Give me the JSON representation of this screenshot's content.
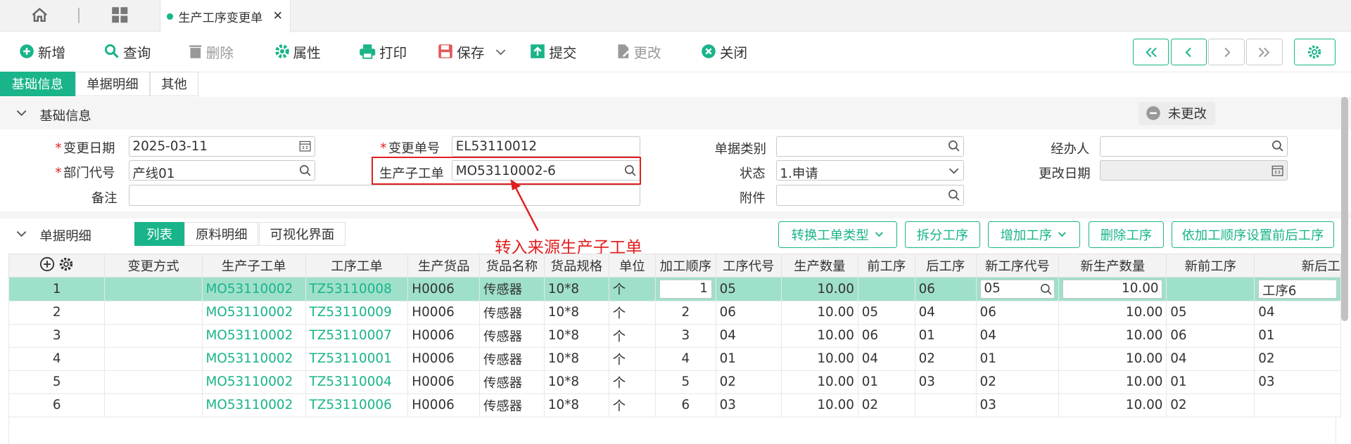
{
  "tabs": {
    "active": "生产工序变更单"
  },
  "toolbar": {
    "new": "新增",
    "query": "查询",
    "delete": "删除",
    "properties": "属性",
    "print": "打印",
    "save": "保存",
    "submit": "提交",
    "modify": "更改",
    "close": "关闭"
  },
  "subtabs": [
    "基础信息",
    "单据明细",
    "其他"
  ],
  "section_basic": {
    "title": "基础信息",
    "status_badge": "未更改"
  },
  "form": {
    "change_date_label": "变更日期",
    "change_date": "2025-03-11",
    "change_no_label": "变更单号",
    "change_no": "EL53110012",
    "doc_type_label": "单据类别",
    "doc_type": "",
    "handler_label": "经办人",
    "handler": "",
    "dept_label": "部门代号",
    "dept": "产线01",
    "sub_order_label": "生产子工单",
    "sub_order": "MO53110002-6",
    "status_label": "状态",
    "status": "1.申请",
    "modify_date_label": "更改日期",
    "modify_date": "",
    "remark_label": "备注",
    "remark": "",
    "attachment_label": "附件",
    "attachment": ""
  },
  "annotation": "转入来源生产子工单",
  "section_detail": {
    "title": "单据明细",
    "tabs": [
      "列表",
      "原料明细",
      "可视化界面"
    ],
    "buttons": [
      "转换工单类型",
      "拆分工序",
      "增加工序",
      "删除工序",
      "依加工顺序设置前后工序"
    ]
  },
  "table": {
    "headers": [
      "",
      "变更方式",
      "生产子工单",
      "工序工单",
      "生产货品",
      "货品名称",
      "货品规格",
      "单位",
      "加工顺序",
      "工序代号",
      "生产数量",
      "前工序",
      "后工序",
      "新工序代号",
      "新生产数量",
      "新前工序",
      "新后工"
    ],
    "rows": [
      [
        "1",
        "",
        "MO53110002",
        "TZ53110008",
        "H0006",
        "传感器",
        "10*8",
        "个",
        "1",
        "05",
        "10.00",
        "",
        "06",
        "05",
        "10.00",
        "",
        "工序6"
      ],
      [
        "2",
        "",
        "MO53110002",
        "TZ53110009",
        "H0006",
        "传感器",
        "10*8",
        "个",
        "2",
        "06",
        "10.00",
        "05",
        "04",
        "06",
        "10.00",
        "05",
        "04"
      ],
      [
        "3",
        "",
        "MO53110002",
        "TZ53110007",
        "H0006",
        "传感器",
        "10*8",
        "个",
        "3",
        "04",
        "10.00",
        "06",
        "01",
        "04",
        "10.00",
        "06",
        "01"
      ],
      [
        "4",
        "",
        "MO53110002",
        "TZ53110001",
        "H0006",
        "传感器",
        "10*8",
        "个",
        "4",
        "01",
        "10.00",
        "04",
        "02",
        "01",
        "10.00",
        "04",
        "02"
      ],
      [
        "5",
        "",
        "MO53110002",
        "TZ53110004",
        "H0006",
        "传感器",
        "10*8",
        "个",
        "5",
        "02",
        "10.00",
        "01",
        "03",
        "02",
        "10.00",
        "01",
        "03"
      ],
      [
        "6",
        "",
        "MO53110002",
        "TZ53110006",
        "H0006",
        "传感器",
        "10*8",
        "个",
        "6",
        "03",
        "10.00",
        "02",
        "",
        "03",
        "10.00",
        "02",
        ""
      ]
    ]
  },
  "colors": {
    "accent": "#19b48a",
    "selected_row": "#9fe0cb",
    "annotation": "#e02020"
  }
}
